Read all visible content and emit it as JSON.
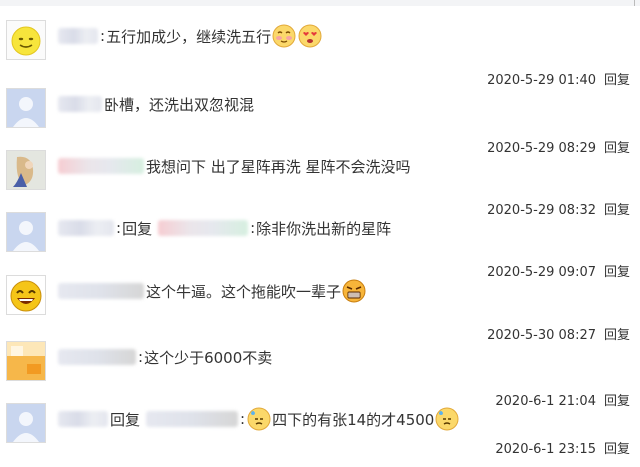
{
  "reply_label": "回复",
  "comments": [
    {
      "avatar": "smiley-yellow-icon",
      "text": "五行加成少，继续洗五行",
      "time": "2020-5-29 01:40"
    },
    {
      "avatar": "default-avatar-icon",
      "text": "卧槽，还洗出双忽视混",
      "time": "2020-5-29 08:29"
    },
    {
      "avatar": "photo-avatar-icon",
      "text": "我想问下 出了星阵再洗 星阵不会洗没吗",
      "time": "2020-5-29 08:32"
    },
    {
      "avatar": "default-avatar-icon",
      "reply_word": "回复",
      "text": "除非你洗出新的星阵",
      "time": "2020-5-29 09:07"
    },
    {
      "avatar": "laughing-avatar-icon",
      "text": "这个牛逼。这个拖能吹一辈子",
      "time": "2020-5-30 08:27"
    },
    {
      "avatar": "orange-photo-avatar-icon",
      "text": "这个少于6000不卖",
      "time": "2020-6-1 21:04"
    },
    {
      "avatar": "default-avatar-icon",
      "reply_word": "回复",
      "text": "四下的有张14的才4500",
      "time": "2020-6-1 23:15"
    }
  ]
}
